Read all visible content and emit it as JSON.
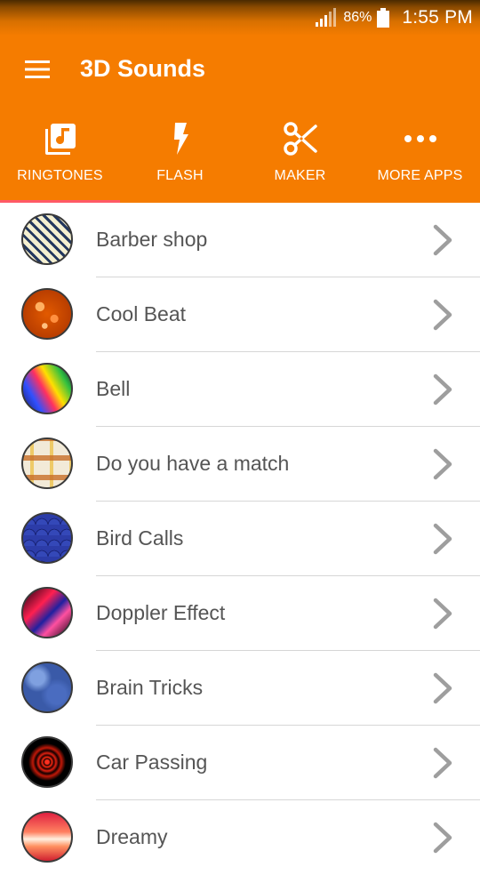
{
  "status_bar": {
    "battery_percent": "86%",
    "time": "1:55 PM"
  },
  "app_bar": {
    "title": "3D Sounds"
  },
  "tabs": [
    {
      "label": "RINGTONES",
      "icon": "music-note-icon",
      "selected": true
    },
    {
      "label": "FLASH",
      "icon": "flash-icon",
      "selected": false
    },
    {
      "label": "MAKER",
      "icon": "scissors-icon",
      "selected": false
    },
    {
      "label": "MORE APPS",
      "icon": "more-dots-icon",
      "selected": false
    }
  ],
  "ringtones": [
    {
      "title": "Barber shop"
    },
    {
      "title": "Cool Beat"
    },
    {
      "title": "Bell"
    },
    {
      "title": "Do you have a match"
    },
    {
      "title": "Bird Calls"
    },
    {
      "title": "Doppler Effect"
    },
    {
      "title": "Brain Tricks"
    },
    {
      "title": "Car Passing"
    },
    {
      "title": "Dreamy"
    }
  ],
  "colors": {
    "primary": "#f57c00",
    "tab_indicator": "#ff5a66",
    "item_text": "#555555",
    "chevron": "#9e9e9e",
    "divider": "#d6d6d6"
  }
}
